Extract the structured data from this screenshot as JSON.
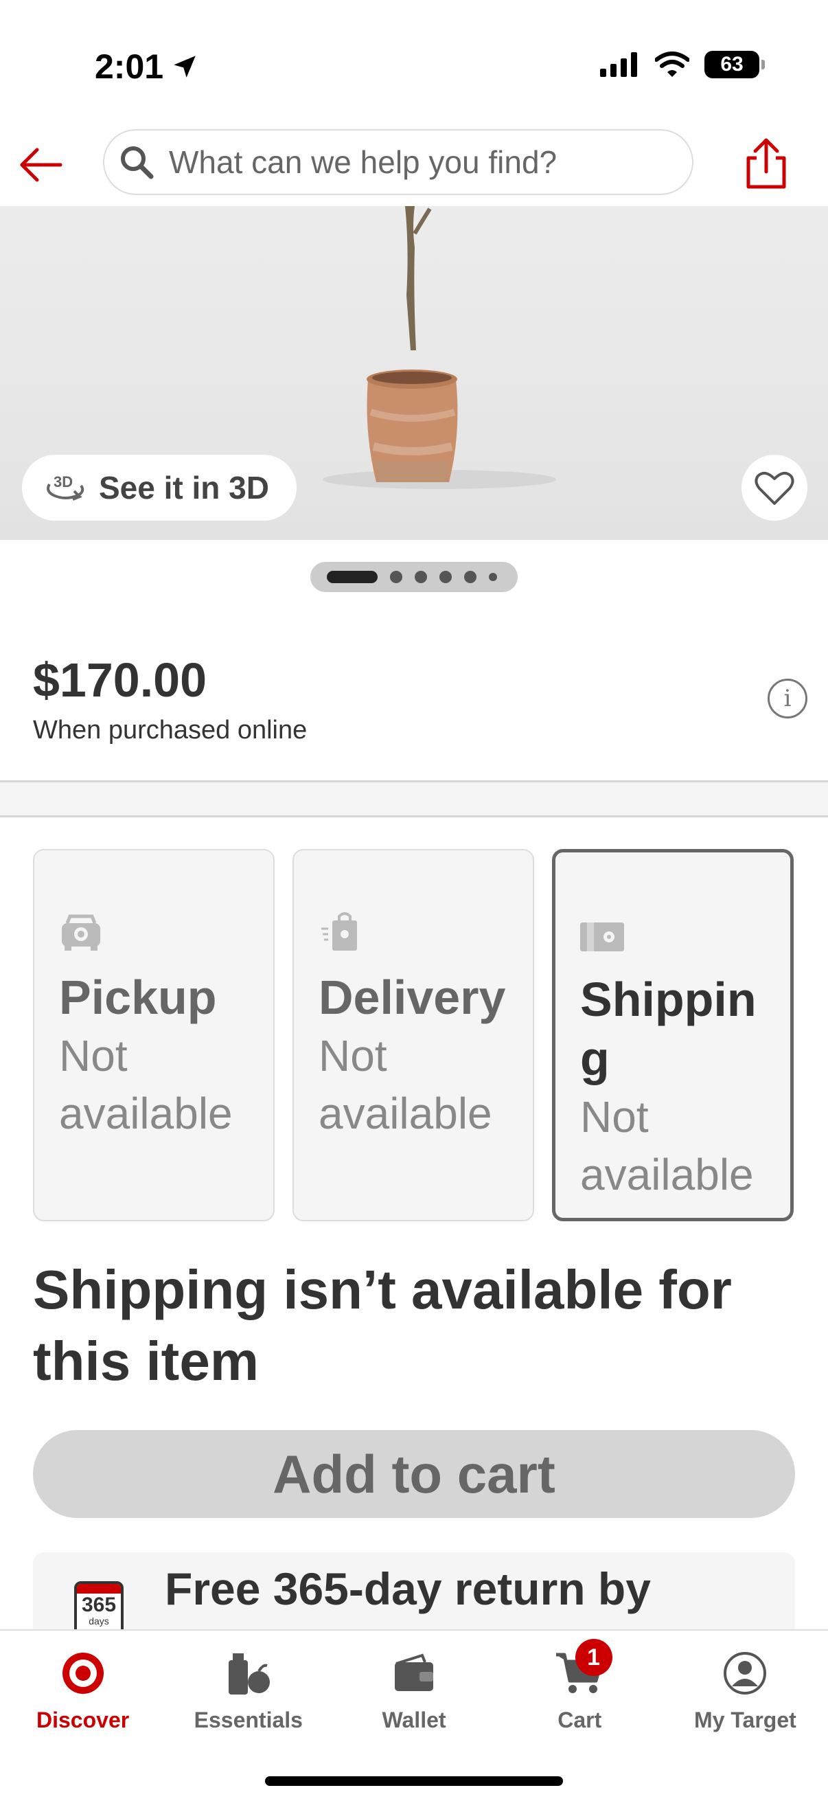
{
  "status_bar": {
    "time": "2:01",
    "battery": "63"
  },
  "search": {
    "placeholder": "What can we help you find?"
  },
  "hero": {
    "see_in_3d_label": "See it in 3D",
    "image_count": 6,
    "active_image": 1
  },
  "price": {
    "amount": "$170.00",
    "note": "When purchased online"
  },
  "fulfillment": [
    {
      "title": "Pickup",
      "status": "Not available",
      "selected": false
    },
    {
      "title": "Delivery",
      "status": "Not available",
      "selected": false
    },
    {
      "title": "Shipping",
      "status": "Not available",
      "selected": true
    }
  ],
  "shipping_message": "Shipping isn’t available for this item",
  "add_to_cart_label": "Add to cart",
  "returns": {
    "calendar_number": "365",
    "calendar_unit": "days",
    "text": "Free 365-day return by"
  },
  "tab_bar": {
    "items": [
      {
        "label": "Discover",
        "active": true
      },
      {
        "label": "Essentials",
        "active": false
      },
      {
        "label": "Wallet",
        "active": false
      },
      {
        "label": "Cart",
        "active": false,
        "badge": "1"
      },
      {
        "label": "My Target",
        "active": false
      }
    ]
  },
  "colors": {
    "brand_red": "#cc0000",
    "text": "#333333",
    "disabled_bg": "#d5d5d5"
  }
}
